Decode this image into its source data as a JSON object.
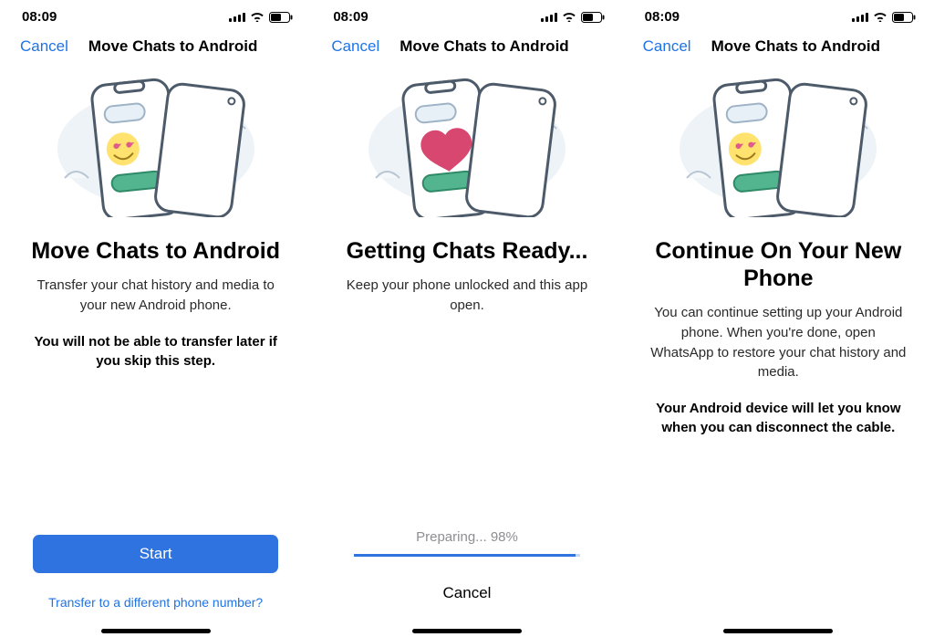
{
  "statusbar": {
    "time": "08:09"
  },
  "navbar": {
    "cancel": "Cancel",
    "title": "Move Chats to Android"
  },
  "screen1": {
    "title": "Move Chats to Android",
    "sub": "Transfer your chat history and media to your new Android phone.",
    "bold": "You will not be able to transfer later if you skip this step.",
    "start": "Start",
    "altlink": "Transfer to a different phone number?"
  },
  "screen2": {
    "title": "Getting Chats Ready...",
    "sub": "Keep your phone unlocked and this app open.",
    "progress": "Preparing... 98%",
    "cancel": "Cancel"
  },
  "screen3": {
    "title": "Continue On Your New Phone",
    "sub": "You can continue setting up your Android phone. When you're done, open WhatsApp to restore your chat history and media.",
    "bold": "Your Android device will let you know when you can disconnect the cable."
  }
}
